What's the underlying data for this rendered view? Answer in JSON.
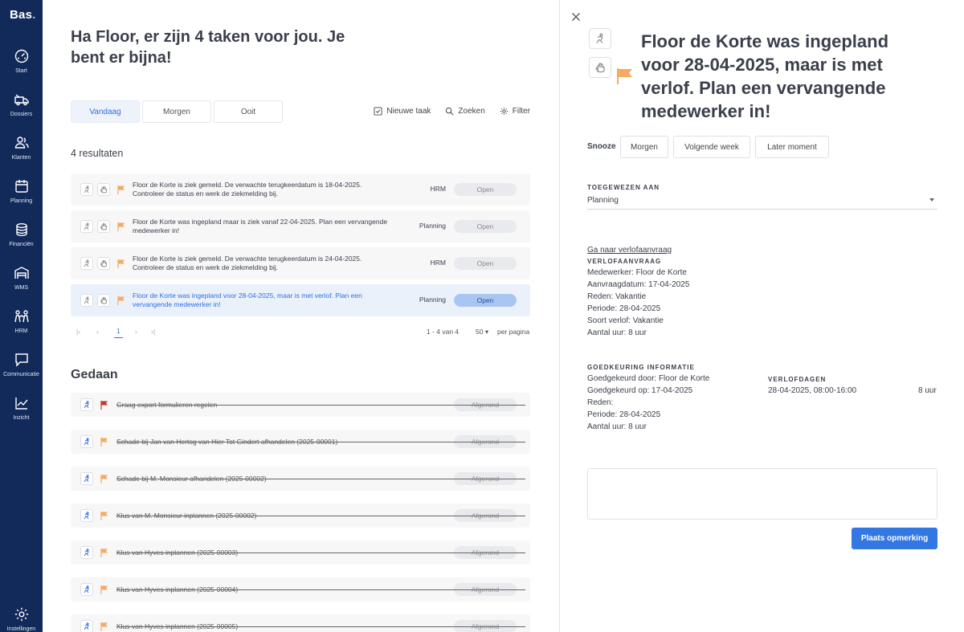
{
  "app": {
    "logo": "Bas",
    "logo_dot": "."
  },
  "sidebar": {
    "items": [
      {
        "label": "Start",
        "icon": "dashboard-icon"
      },
      {
        "label": "Dossiers",
        "icon": "truck-icon"
      },
      {
        "label": "Klanten",
        "icon": "users-icon"
      },
      {
        "label": "Planning",
        "icon": "calendar-icon"
      },
      {
        "label": "Financiën",
        "icon": "coins-icon"
      },
      {
        "label": "WMS",
        "icon": "warehouse-icon"
      },
      {
        "label": "HRM",
        "icon": "people-icon"
      },
      {
        "label": "Communicatie",
        "icon": "chat-icon"
      },
      {
        "label": "Inzicht",
        "icon": "chart-icon"
      },
      {
        "label": "Instellingen",
        "icon": "gear-icon"
      }
    ]
  },
  "main": {
    "greeting": "Ha Floor, er zijn 4 taken voor jou. Je bent er bijna!",
    "tabs": [
      {
        "label": "Vandaag",
        "active": true
      },
      {
        "label": "Morgen",
        "active": false
      },
      {
        "label": "Ooit",
        "active": false
      }
    ],
    "toolbar": {
      "new_task": "Nieuwe taak",
      "search": "Zoeken",
      "filter": "Filter"
    },
    "results": "4 resultaten",
    "tasks": [
      {
        "text": "Floor de Korte is ziek gemeld. De verwachte terugkeerdatum is 18-04-2025. Controleer de status en werk de ziekmelding bij.",
        "dept": "HRM",
        "status": "Open"
      },
      {
        "text": "Floor de Korte was ingepland maar is ziek vanaf 22-04-2025. Plan een vervangende medewerker in!",
        "dept": "Planning",
        "status": "Open"
      },
      {
        "text": "Floor de Korte is ziek gemeld. De verwachte terugkeerdatum is 24-04-2025. Controleer de status en werk de ziekmelding bij.",
        "dept": "HRM",
        "status": "Open"
      },
      {
        "text": "Floor de Korte was ingepland voor 28-04-2025, maar is met verlof. Plan een vervangende medewerker in!",
        "dept": "Planning",
        "status": "Open"
      }
    ],
    "pager": {
      "first": "|‹",
      "prev": "‹",
      "current": "1",
      "next": "›",
      "last": "›|",
      "range": "1 - 4 van 4",
      "per_page_value": "50",
      "per_page_label": "per pagina"
    },
    "done_title": "Gedaan",
    "done_tasks": [
      {
        "text": "Graag export formulieren regelen",
        "status": "Afgerond",
        "flag_color": "#c0392b"
      },
      {
        "text": "Schade bij Jan van Hertog van Hier Tot Gindert afhandelen (2025-00001)",
        "status": "Afgerond",
        "flag_color": "#f5a962"
      },
      {
        "text": "Schade bij M. Monsieur afhandelen (2025-00002)",
        "status": "Afgerond",
        "flag_color": "#f5a962"
      },
      {
        "text": "Klus van M. Monsieur inplannen (2025-00002)",
        "status": "Afgerond",
        "flag_color": "#f5a962"
      },
      {
        "text": "Klus van Hyves inplannen (2025-00003)",
        "status": "Afgerond",
        "flag_color": "#f5a962"
      },
      {
        "text": "Klus van Hyves inplannen (2025-00004)",
        "status": "Afgerond",
        "flag_color": "#f5a962"
      },
      {
        "text": "Klus van Hyves inplannen (2025-00005)",
        "status": "Afgerond",
        "flag_color": "#f5a962"
      }
    ]
  },
  "panel": {
    "title": "Floor de Korte was ingepland voor 28-04-2025, maar is met verlof. Plan een vervangende medewerker in!",
    "snooze": {
      "label": "Snooze",
      "options": [
        "Morgen",
        "Volgende week",
        "Later moment"
      ]
    },
    "assigned": {
      "label": "TOEGEWEZEN AAN",
      "value": "Planning"
    },
    "link": "Ga naar verlofaanvraag",
    "leave": {
      "label": "VERLOFAANVRAAG",
      "employee": "Medewerker: Floor de Korte",
      "request_date": "Aanvraagdatum: 17-04-2025",
      "reason": "Reden: Vakantie",
      "period": "Periode: 28-04-2025",
      "type": "Soort verlof: Vakantie",
      "hours": "Aantal uur: 8 uur"
    },
    "approval": {
      "label": "GOEDKEURING INFORMATIE",
      "by": "Goedgekeurd door: Floor de Korte",
      "on": "Goedgekeurd op: 17-04-2025",
      "reason": "Reden:",
      "period": "Periode: 28-04-2025",
      "hours": "Aantal uur: 8 uur"
    },
    "leave_days": {
      "label": "VERLOFDAGEN",
      "date": "28-04-2025, 08:00-16:00",
      "hours": "8 uur"
    },
    "submit": "Plaats opmerking"
  },
  "colors": {
    "sidebar": "#122a5a",
    "accent": "#3377e3",
    "flag": "#f5a962"
  }
}
